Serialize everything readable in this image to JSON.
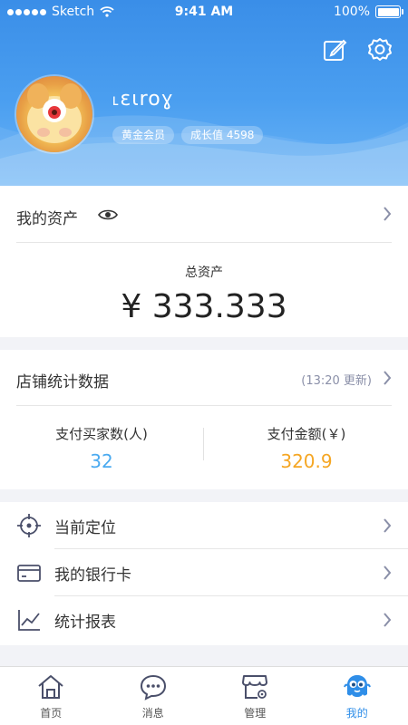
{
  "status_bar": {
    "carrier": "Sketch",
    "time": "9:41 AM",
    "battery": "100%"
  },
  "header": {
    "username": "˪ɛɩroɣ",
    "member_badge": "黄金会员",
    "growth_badge": "成长值 4598",
    "icons": [
      "edit-icon",
      "settings-icon"
    ]
  },
  "assets": {
    "title": "我的资产",
    "total_label": "总资产",
    "total_value": "¥ 333.333"
  },
  "store_stats": {
    "title": "店铺统计数据",
    "update_note": "(13:20 更新)",
    "buyers_label": "支付买家数(人)",
    "buyers_value": "32",
    "amount_label": "支付金额(￥)",
    "amount_value": "320.9"
  },
  "menu": {
    "items": [
      {
        "label": "当前定位",
        "icon": "location-icon"
      },
      {
        "label": "我的银行卡",
        "icon": "bank-card-icon"
      },
      {
        "label": "统计报表",
        "icon": "chart-icon"
      }
    ]
  },
  "tabbar": {
    "tabs": [
      {
        "label": "首页",
        "icon": "home-icon"
      },
      {
        "label": "消息",
        "icon": "message-icon"
      },
      {
        "label": "管理",
        "icon": "store-manage-icon"
      },
      {
        "label": "我的",
        "icon": "profile-mascot-icon"
      }
    ],
    "active_tab": "我的"
  },
  "colors": {
    "header_blue": "#3a8ee8",
    "buyers_value": "#4aaaf0",
    "amount_value": "#f5a623",
    "active_tab": "#2f8ee8"
  }
}
